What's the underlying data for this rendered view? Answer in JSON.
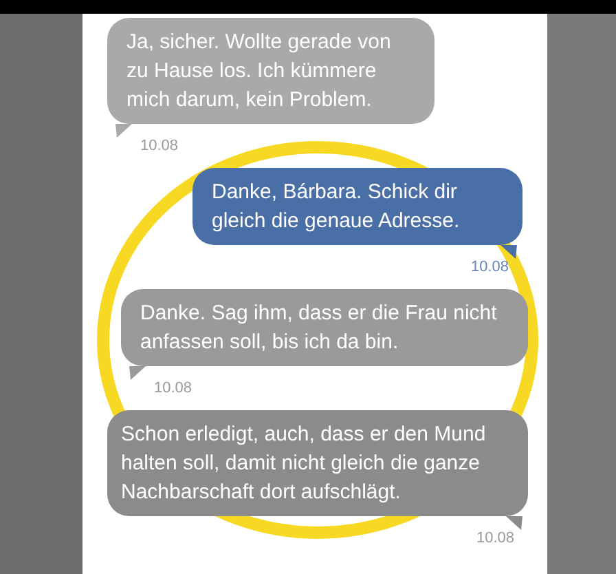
{
  "messages": [
    {
      "kind": "incoming",
      "color": "#a9a9a9",
      "text": "Ja, sicher. Wollte gerade von zu Hause los. Ich kümmere mich darum, kein Problem.",
      "time": "10.08"
    },
    {
      "kind": "outgoing",
      "color": "#4a6ea6",
      "text": "Danke, Bárbara. Schick dir gleich die genaue Adresse.",
      "time": "10.08"
    },
    {
      "kind": "incoming",
      "color": "#9a9a9a",
      "text": "Danke. Sag ihm, dass er die Frau nicht anfassen soll, bis ich da bin.",
      "time": "10.08"
    },
    {
      "kind": "outgoing",
      "color": "#8b8b8b",
      "text": "Schon erledigt, auch, dass er den Mund halten soll, damit nicht gleich die ganze Nachbarschaft dort aufschlägt.",
      "time": "10.08"
    }
  ]
}
